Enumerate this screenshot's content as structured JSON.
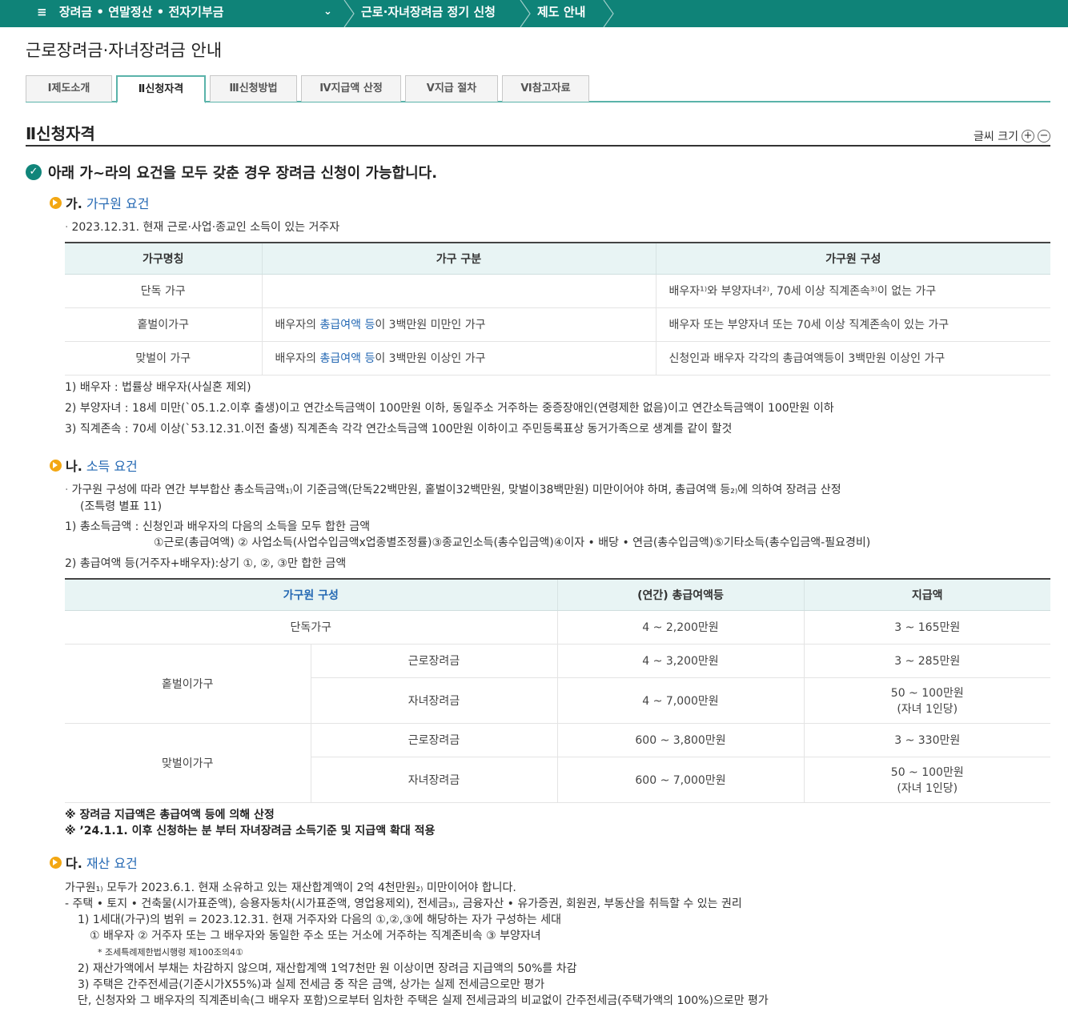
{
  "nav": {
    "menu_label": "장려금 • 연말정산 • 전자기부금",
    "crumb1": "근로·자녀장려금 정기 신청",
    "crumb2": "제도 안내"
  },
  "page_title": "근로장려금·자녀장려금 안내",
  "tabs": [
    "Ⅰ제도소개",
    "Ⅱ신청자격",
    "Ⅲ신청방법",
    "Ⅳ지급액 산정",
    "Ⅴ지급 절차",
    "Ⅵ참고자료"
  ],
  "section_title": "Ⅱ신청자격",
  "font_size_label": "글씨 크기",
  "lead": "아래 가~라의 요건을 모두 갖춘 경우 장려금 신청이 가능합니다.",
  "a": {
    "prefix": "가.",
    "title": "가구원 요건",
    "desc": "2023.12.31. 현재 근로·사업·종교인 소득이 있는 거주자",
    "table": {
      "headers": [
        "가구명칭",
        "가구 구분",
        "가구원 구성"
      ],
      "rows": [
        {
          "name": "단독 가구",
          "kind_pre": "",
          "kind_link": "",
          "kind_post": "",
          "comp": "배우자¹⁾와 부양자녀²⁾, 70세 이상 직계존속³⁾이 없는 가구"
        },
        {
          "name": "홑벌이가구",
          "kind_pre": "배우자의 ",
          "kind_link": "총급여액 등",
          "kind_post": "이 3백만원 미만인 가구",
          "comp": "배우자 또는 부양자녀 또는 70세 이상 직계존속이 있는 가구"
        },
        {
          "name": "맞벌이 가구",
          "kind_pre": "배우자의 ",
          "kind_link": "총급여액 등",
          "kind_post": "이 3백만원 이상인 가구",
          "comp": "신청인과 배우자 각각의 총급여액등이 3백만원 이상인 가구"
        }
      ]
    },
    "notes": [
      "1) 배우자 : 법률상 배우자(사실혼 제외)",
      "2) 부양자녀 : 18세 미만(`05.1.2.이후 출생)이고 연간소득금액이 100만원 이하, 동일주소 거주하는 중증장애인(연령제한 없음)이고 연간소득금액이 100만원 이하",
      "3) 직계존속 : 70세 이상(`53.12.31.이전 출생) 직계존속 각각 연간소득금액 100만원 이하이고 주민등록표상 동거가족으로 생계를 같이 할것"
    ]
  },
  "b": {
    "prefix": "나.",
    "title": "소득 요건",
    "desc1": "가구원 구성에 따라 연간 부부합산 총소득금액₁₎이 기준금액(단독22백만원, 홑벌이32백만원, 맞벌이38백만원) 미만이어야 하며, 총급여액 등₂₎에 의하여 장려금 산정",
    "desc2": "(조특령 별표 11)",
    "note1": "1) 총소득금액 : 신청인과 배우자의 다음의 소득을 모두 합한 금액",
    "note1b": "①근로(총급여액) ② 사업소득(사업수입금액x업종별조정률)③종교인소득(총수입금액)④이자 • 배당 • 연금(총수입금액)⑤기타소득(총수입금액-필요경비)",
    "note2": "2) 총급여액 등(거주자+배우자):상기 ①, ②, ③만 합한 금액",
    "table": {
      "headers": [
        "가구원 구성",
        "(연간) 총급여액등",
        "지급액"
      ],
      "single": {
        "name": "단독가구",
        "range": "4 ~ 2,200만원",
        "amount": "3 ~ 165만원"
      },
      "one": {
        "name": "홑벌이가구",
        "r1": {
          "type": "근로장려금",
          "range": "4 ~ 3,200만원",
          "amount": "3 ~ 285만원"
        },
        "r2": {
          "type": "자녀장려금",
          "range": "4 ~ 7,000만원",
          "amount": "50 ~ 100만원",
          "amount2": "(자녀 1인당)"
        }
      },
      "two": {
        "name": "맞벌이가구",
        "r1": {
          "type": "근로장려금",
          "range": "600 ~ 3,800만원",
          "amount": "3 ~ 330만원"
        },
        "r2": {
          "type": "자녀장려금",
          "range": "600 ~ 7,000만원",
          "amount": "50 ~ 100만원",
          "amount2": "(자녀 1인당)"
        }
      }
    },
    "remark1": "※ 장려금 지급액은 총급여액 등에 의해 산정",
    "remark2": "※ ’24.1.1. 이후 신청하는 분 부터 자녀장려금 소득기준 및 지급액 확대 적용"
  },
  "c": {
    "prefix": "다.",
    "title": "재산 요건",
    "lines": [
      "가구원₁₎ 모두가 2023.6.1. 현재 소유하고 있는 재산합계액이 2억 4천만원₂₎ 미만이어야 합니다.",
      "- 주택 • 토지 • 건축물(시가표준액), 승용자동차(시가표준액, 영업용제외), 전세금₃₎, 금융자산 • 유가증권, 회원권, 부동산을 취득할 수 있는 권리",
      "1) 1세대(가구)의 범위 = 2023.12.31. 현재 거주자와 다음의 ①,②,③에 해당하는 자가 구성하는 세대",
      "① 배우자 ② 거주자 또는 그 배우자와 동일한 주소 또는 거소에 거주하는 직계존비속 ③ 부양자녀",
      "* 조세특례제한법시행령 제100조의4①",
      "2) 재산가액에서 부채는 차감하지 않으며, 재산합계액 1억7천만 원 이상이면 장려금 지급액의 50%를 차감",
      "3) 주택은 간주전세금(기준시가X55%)과 실제 전세금 중 작은 금액, 상가는 실제 전세금으로만 평가",
      "단, 신청자와 그 배우자의 직계존비속(그 배우자 포함)으로부터 임차한 주택은 실제 전세금과의 비교없이 간주전세금(주택가액의 100%)으로만 평가"
    ]
  }
}
